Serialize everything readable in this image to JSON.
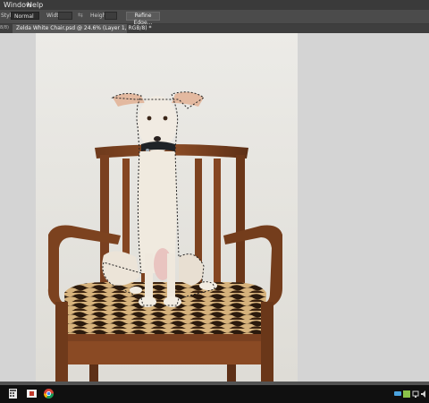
{
  "menu": {
    "window": "Window",
    "help": "Help"
  },
  "options": {
    "style_label": "Style:",
    "style_value": "Normal",
    "width_label": "Width:",
    "height_label": "Height:",
    "refine_edge": "Refine Edge..."
  },
  "document": {
    "prev_tab": "8/8)",
    "active_tab": "Zelda White Chair.psd @ 24.6% (Layer 1, RGB/8) *"
  },
  "taskbar": {
    "icons": [
      "calculator-icon",
      "media-app-icon",
      "chrome-icon",
      "chat-icon",
      "tray-app-icon",
      "network-icon",
      "volume-icon"
    ]
  }
}
